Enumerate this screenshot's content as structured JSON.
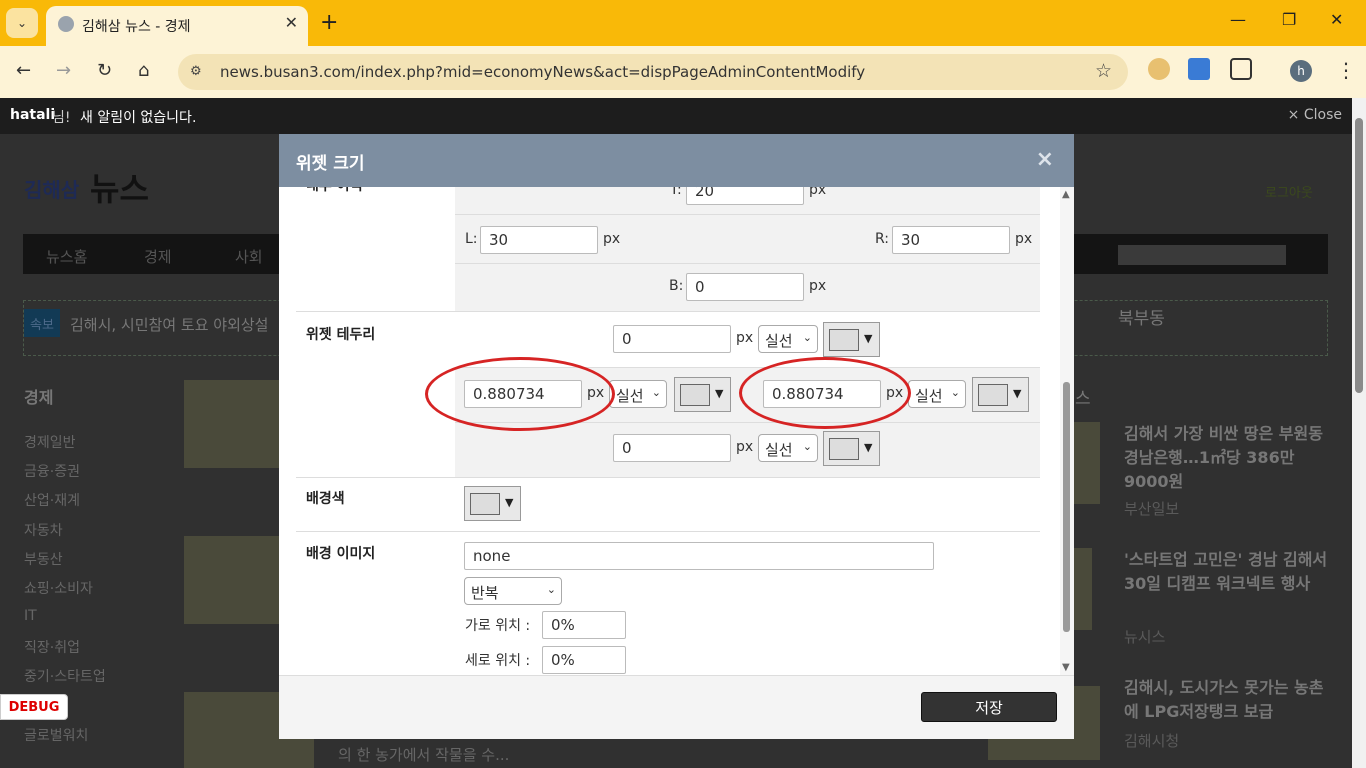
{
  "browser": {
    "tab_title": "김해삼 뉴스 - 경제",
    "new_tab": "+",
    "url": "news.busan3.com/index.php?mid=economyNews&act=dispPageAdminContentModify",
    "avatar_letter": "h"
  },
  "notice": {
    "user": "hatali",
    "suffix": "님!",
    "message": "새 알림이 없습니다.",
    "close": "× Close"
  },
  "site": {
    "logo_small": "김해삼",
    "logo_big": "뉴스",
    "logout": "로그아웃",
    "nav": [
      "뉴스홈",
      "경제",
      "사회"
    ],
    "breaking_tag": "속보",
    "breaking_text": "김해시, 시민참여 토요 야외상설",
    "weather": "북부동",
    "side_title": "경제",
    "side_items": [
      "경제일반",
      "금융·증권",
      "산업·재계",
      "자동차",
      "부동산",
      "쇼핑·소비자",
      "IT",
      "직장·취업",
      "중기·스타트업",
      "글로벌워치"
    ],
    "right_head": "스",
    "news": [
      {
        "title": "김해서 가장 비싼 땅은 부원동 경남은행…1㎡당 386만 9000원",
        "source": "부산일보"
      },
      {
        "title": "'스타트업 고민은' 경남 김해서 30일 디캠프 워크넥트 행사",
        "source": "뉴시스"
      },
      {
        "title": "김해시, 도시가스 못가는 농촌에 LPG저장탱크 보급",
        "source": "김해시청"
      }
    ],
    "bottom_text": "의 한 농가에서 작물을 수..."
  },
  "debug_label": "DEBUG",
  "modal": {
    "title": "위젯 크기",
    "close": "×",
    "inner_margin_label": "내부 여백",
    "padding": {
      "T_label": "T:",
      "T": "20",
      "L_label": "L:",
      "L": "30",
      "R_label": "R:",
      "R": "30",
      "B_label": "B:",
      "B": "0",
      "unit": "px"
    },
    "border_label": "위젯 테두리",
    "border": {
      "top": "0",
      "left": "0.880734",
      "right": "0.880734",
      "bottom": "0",
      "unit": "px",
      "style": "실선"
    },
    "bg_color_label": "배경색",
    "bg_image_label": "배경 이미지",
    "bg_image_value": "none",
    "repeat_value": "반복",
    "hpos_label": "가로 위치 :",
    "hpos_value": "0%",
    "vpos_label": "세로 위치 :",
    "vpos_value": "0%",
    "save": "저장"
  }
}
